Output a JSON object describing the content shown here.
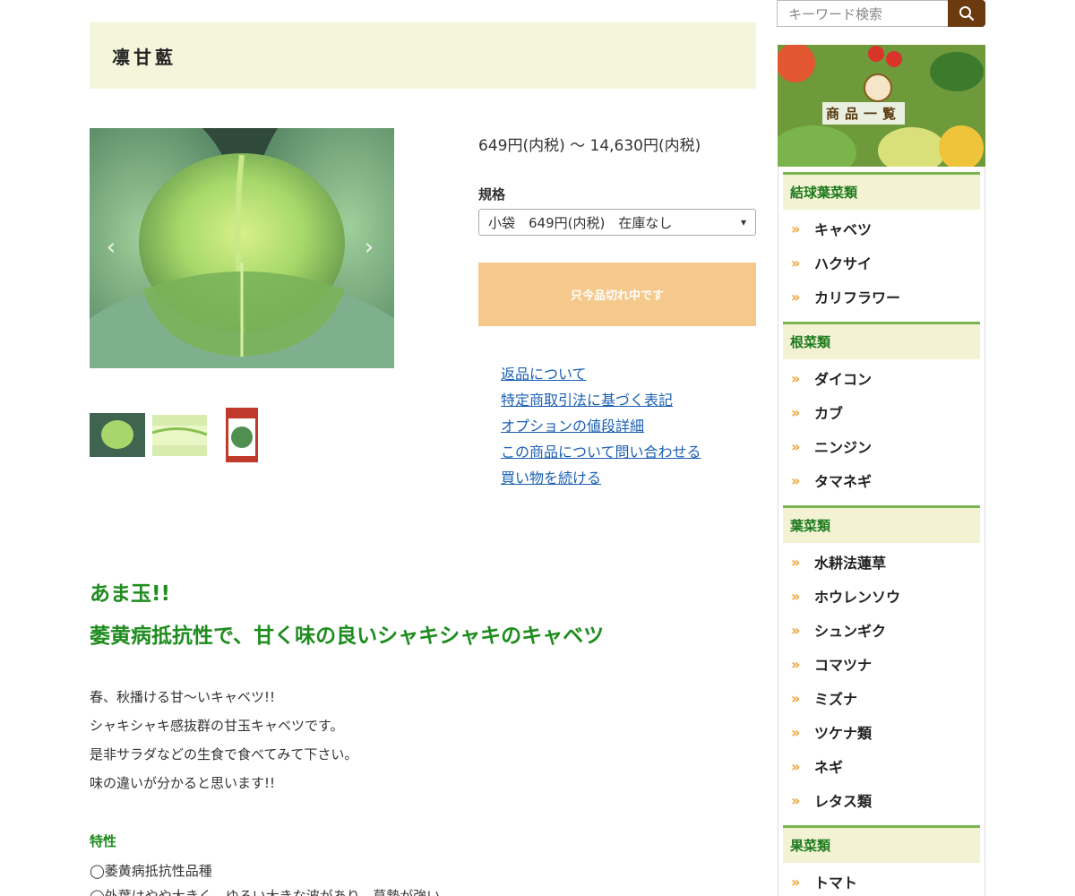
{
  "product": {
    "title": "凛甘藍",
    "price": "649円(内税) 〜 14,630円(内税)",
    "spec_label": "規格",
    "spec_selected": "小袋　649円(内税)　在庫なし",
    "soldout_label": "只今品切れ中です"
  },
  "links": [
    "返品について",
    "特定商取引法に基づく表記",
    "オプションの値段詳細",
    "この商品について問い合わせる",
    "買い物を続ける"
  ],
  "content": {
    "catch1": "あま玉!!",
    "catch2": "萎黄病抵抗性で、甘く味の良いシャキシャキのキャベツ",
    "desc": [
      "春、秋播ける甘〜いキャベツ!!",
      "シャキシャキ感抜群の甘玉キャベツです。",
      "是非サラダなどの生食で食べてみて下さい。",
      "味の違いが分かると思います!!"
    ],
    "feature_title": "特性",
    "features": [
      "◯萎黄病抵抗性品種",
      "◯外葉はやや大きく、ゆるい大きな波があり、草勢が強い"
    ]
  },
  "search": {
    "placeholder": "キーワード検索"
  },
  "sidebar": {
    "banner_label": "商品一覧",
    "categories": [
      {
        "name": "結球葉菜類",
        "items": [
          "キャベツ",
          "ハクサイ",
          "カリフラワー"
        ]
      },
      {
        "name": "根菜類",
        "items": [
          "ダイコン",
          "カブ",
          "ニンジン",
          "タマネギ"
        ]
      },
      {
        "name": "葉菜類",
        "items": [
          "水耕法蓮草",
          "ホウレンソウ",
          "シュンギク",
          "コマツナ",
          "ミズナ",
          "ツケナ類",
          "ネギ",
          "レタス類"
        ]
      },
      {
        "name": "果菜類",
        "items": [
          "トマト"
        ]
      }
    ]
  },
  "colors": {
    "banner_bg": "#f5f5dc",
    "soldout_bg": "#f5c98c",
    "heading_green": "#1e8c1e",
    "link_blue": "#1a5fb4",
    "search_btn": "#6b3a0e",
    "chevron_orange": "#f0a030"
  },
  "icons": {
    "search": "search-icon",
    "prev": "chevron-left-icon",
    "next": "chevron-right-icon",
    "list_bullet": "double-chevron-right-icon"
  }
}
